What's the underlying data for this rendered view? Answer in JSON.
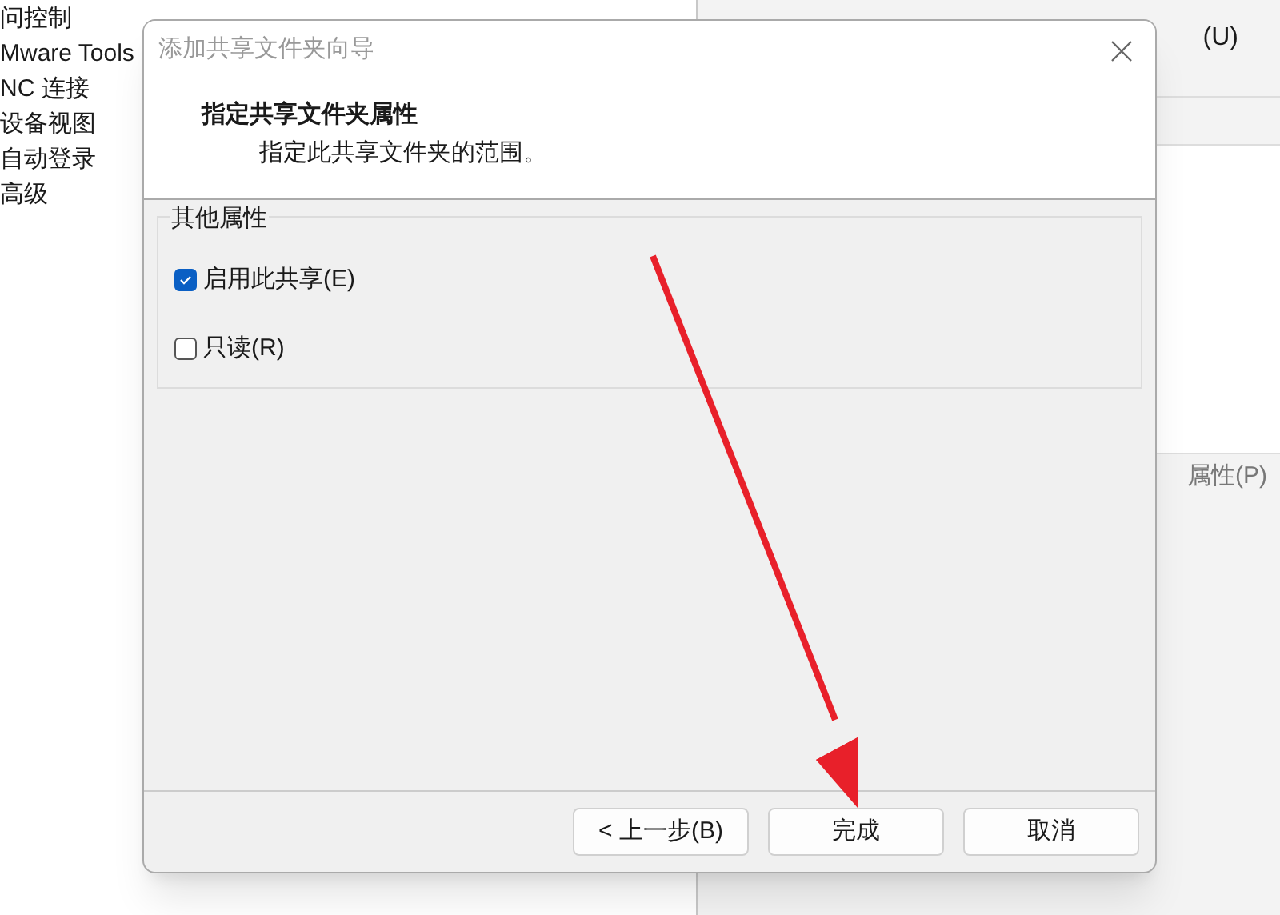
{
  "background": {
    "sidebar_items": [
      "问控制",
      "Mware Tools",
      "NC 连接",
      "设备视图",
      "自动登录",
      "高级"
    ],
    "right_label": "(U)",
    "properties_button": "属性(P)"
  },
  "dialog": {
    "title": "添加共享文件夹向导",
    "heading": "指定共享文件夹属性",
    "subheading": "指定此共享文件夹的范围。",
    "group": {
      "title": "其他属性",
      "options": [
        {
          "label": "启用此共享(E)",
          "checked": true
        },
        {
          "label": "只读(R)",
          "checked": false
        }
      ]
    },
    "buttons": [
      "< 上一步(B)",
      "完成",
      "取消"
    ]
  }
}
